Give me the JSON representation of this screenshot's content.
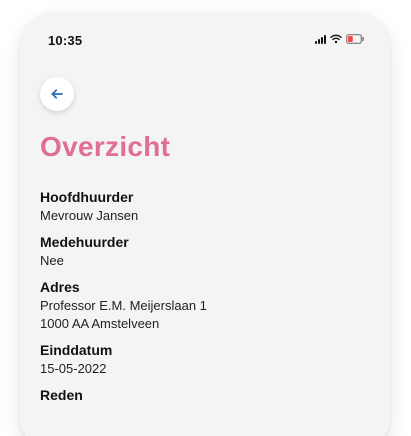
{
  "status_bar": {
    "time": "10:35",
    "icons": [
      "signal-icon",
      "wifi-icon",
      "battery-icon"
    ],
    "battery_color": "#f24a4a"
  },
  "header": {
    "back_icon": "arrow-left-icon",
    "title": "Overzicht",
    "title_color": "#df6f97"
  },
  "details": [
    {
      "label": "Hoofdhuurder",
      "value": "Mevrouw Jansen"
    },
    {
      "label": "Medehuurder",
      "value": "Nee"
    },
    {
      "label": "Adres",
      "value_line_1": "Professor E.M. Meijerslaan 1",
      "value_line_2": "1000 AA Amstelveen"
    },
    {
      "label": "Einddatum",
      "value": "15-05-2022"
    },
    {
      "label": "Reden"
    }
  ]
}
